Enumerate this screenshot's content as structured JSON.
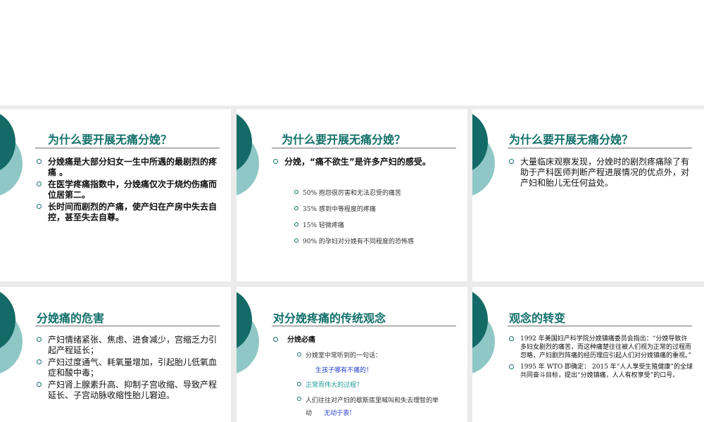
{
  "slides": [
    {
      "title": "为什么要开展无痛分娩？",
      "bullets": [
        "分娩痛是大部分妇女一生中所遇的最剧烈的疼痛 。",
        "在医学疼痛指数中，分娩痛仅次于烧灼伤痛而位居第二。",
        "长时间而剧烈的产痛，使产妇在产房中失去自控，甚至失去自尊。"
      ]
    },
    {
      "title": "为什么要开展无痛分娩？",
      "bullets": [
        "分娩，“痛不欲生”是许多产妇的感受。"
      ],
      "sub": [
        "50% 抱怨很厉害和无法忍受的痛苦",
        "35% 感到中等程度的疼痛",
        "15% 轻微疼痛",
        "90% 的孕妇对分娩有不同程度的恐怖感"
      ]
    },
    {
      "title": "为什么要开展无痛分娩？",
      "bullets": [
        "大量临床观察发现，分娩时的剧烈疼痛除了有助于产科医师判断产程进展情况的优点外，对产妇和胎儿无任何益处。"
      ]
    },
    {
      "title": "分娩痛的危害",
      "bullets": [
        "产妇情绪紧张、焦虑、进食减少，宫缩乏力引起产程延长；",
        "产妇过度通气、耗氧量增加，引起胎儿低氧血症和酸中毒；",
        "产妇肾上腺素升高、抑制子宫收缩、导致产程延长、子宫动脉收缩性胎儿窘迫。"
      ]
    },
    {
      "title": "对分娩疼痛的传统观念",
      "bullets": [
        "分娩必痛"
      ],
      "sub": [
        "分娩室中常听到的一句话：",
        "生孩子哪有不痛的！",
        "正常而伟大的过程?",
        "人们往往对产妇的歇斯底里喊叫和失去理智的举动",
        "无动于衷!"
      ]
    },
    {
      "title": "观念的转变",
      "bullets": [
        "1992 年美国妇产科学院分娩镇痛委员会指出：“分娩导致许多妇女剧烈的痛苦，而这种痛楚往往被人们视为正常的过程而忽略，产妇剧烈阵痛的经历理应引起人们对分娩镇痛的重视。”",
        "1995 年 WTO 即确定： 2015 年“人人享受生殖健康”的全球共同奋斗目标，提出“分娩镇痛，人人有权享受”的口号。"
      ]
    }
  ]
}
